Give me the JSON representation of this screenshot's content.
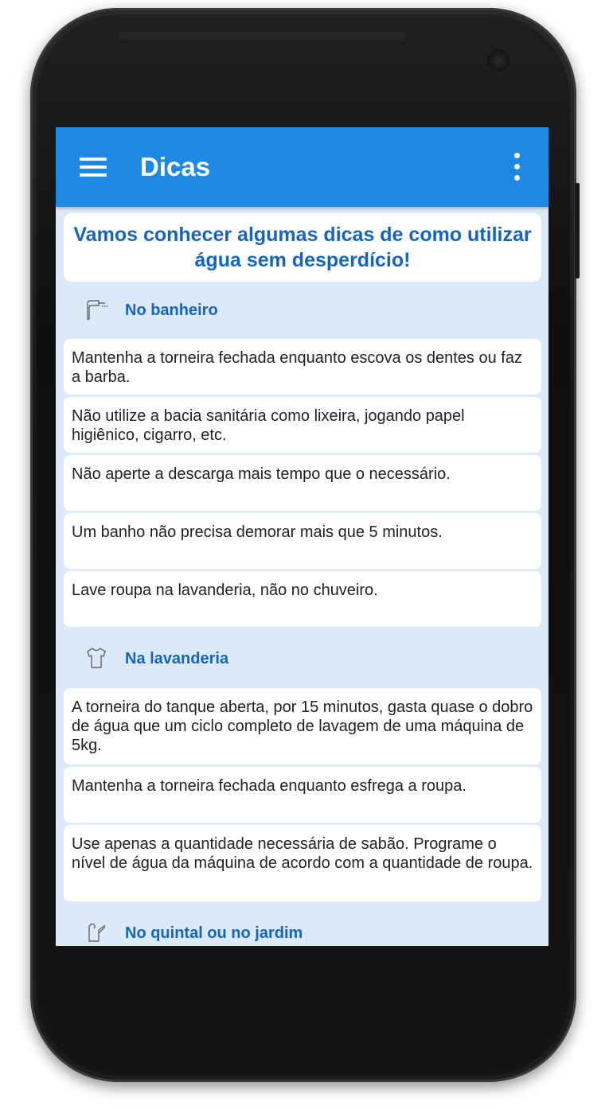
{
  "appbar": {
    "title": "Dicas",
    "accent_color": "#1e88e5",
    "menu_icon": "menu-icon",
    "more_icon": "more-vertical-icon"
  },
  "intro": "Vamos conhecer algumas dicas de como utilizar água sem desperdício!",
  "sections": [
    {
      "title": "No banheiro",
      "icon": "shower-icon",
      "tips": [
        "Mantenha a torneira fechada enquanto escova os dentes ou faz a barba.",
        "Não utilize a bacia sanitária como lixeira, jogando papel higiênico, cigarro, etc.",
        "Não aperte a descarga mais tempo que o necessário.",
        "Um banho não precisa demorar mais que 5 minutos.",
        "Lave roupa na lavanderia, não no chuveiro."
      ]
    },
    {
      "title": "Na lavanderia",
      "icon": "shirt-icon",
      "tips": [
        "A torneira do tanque aberta, por 15 minutos, gasta quase o dobro de água que um ciclo completo de lavagem de uma máquina de 5kg.",
        "Mantenha a torneira fechada enquanto esfrega a roupa.",
        "Use apenas a quantidade necessária de sabão. Programe o nível de água da máquina de acordo com a quantidade de roupa."
      ]
    },
    {
      "title": "No quintal ou no jardim",
      "icon": "watering-can-icon",
      "tips": []
    }
  ]
}
